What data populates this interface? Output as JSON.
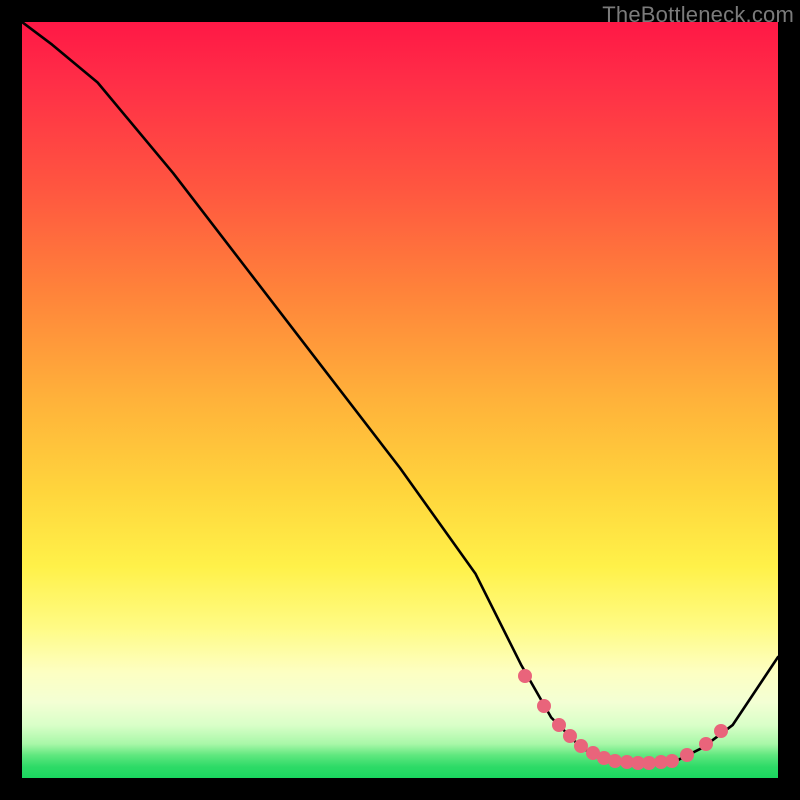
{
  "watermark": "TheBottleneck.com",
  "colors": {
    "marker": "#e9647b",
    "curve": "#000000"
  },
  "chart_data": {
    "type": "line",
    "title": "",
    "xlabel": "",
    "ylabel": "",
    "xlim": [
      0,
      100
    ],
    "ylim": [
      0,
      100
    ],
    "grid": false,
    "legend": false,
    "series": [
      {
        "name": "bottleneck-curve",
        "x": [
          0,
          4,
          10,
          20,
          30,
          40,
          50,
          60,
          66,
          70,
          74,
          78,
          82,
          86,
          90,
          94,
          100
        ],
        "y": [
          100,
          97,
          92,
          80,
          67,
          54,
          41,
          27,
          15,
          8,
          4,
          2,
          2,
          2,
          4,
          7,
          16
        ]
      }
    ],
    "markers": {
      "name": "highlighted-range",
      "x": [
        66.5,
        69.0,
        71.0,
        72.5,
        74.0,
        75.5,
        77.0,
        78.5,
        80.0,
        81.5,
        83.0,
        84.5,
        86.0,
        88.0,
        90.5,
        92.5
      ],
      "y": [
        13.5,
        9.5,
        7.0,
        5.5,
        4.2,
        3.3,
        2.7,
        2.3,
        2.1,
        2.0,
        2.0,
        2.1,
        2.3,
        3.0,
        4.5,
        6.2
      ]
    }
  }
}
